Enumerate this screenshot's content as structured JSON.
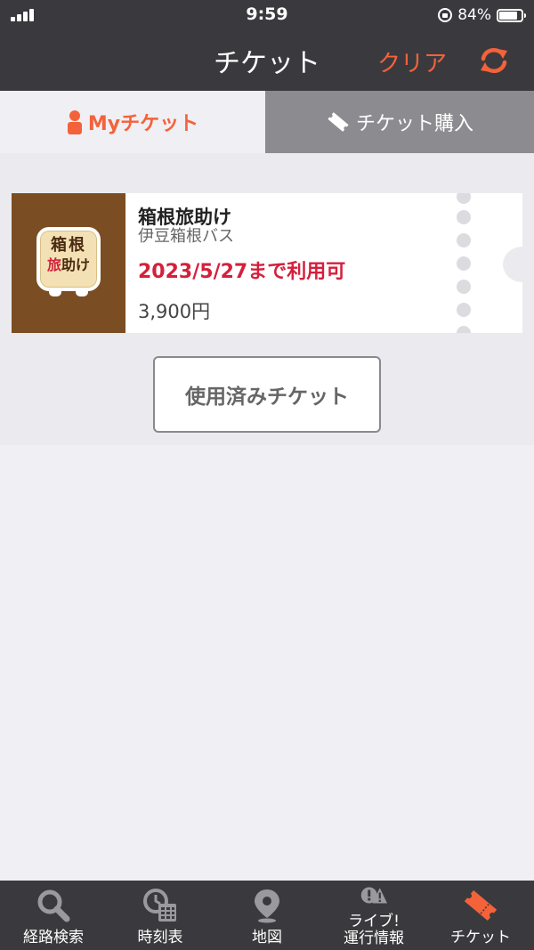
{
  "status_bar": {
    "time": "9:59",
    "battery": "84%",
    "battery_level": 0.84
  },
  "nav": {
    "title": "チケット",
    "clear_label": "クリア",
    "refresh_icon": "refresh-icon"
  },
  "tabs": {
    "my_ticket": {
      "label": "Myチケット",
      "icon": "person-icon"
    },
    "purchase": {
      "label": "チケット購入",
      "icon": "ticket-icon"
    }
  },
  "ticket": {
    "name": "箱根旅助け",
    "company": "伊豆箱根バス",
    "expiry": "2023/5/27まで利用可",
    "price": "3,900円",
    "logo_text": "箱根旅助け"
  },
  "used_tickets_label": "使用済みチケット",
  "tab_bar": {
    "items": [
      {
        "label": "経路検索",
        "icon": "search-icon"
      },
      {
        "label": "時刻表",
        "icon": "timetable-icon"
      },
      {
        "label": "地図",
        "icon": "map-pin-icon"
      },
      {
        "label_line1": "ライブ!",
        "label_line2": "運行情報",
        "icon": "alert-icon"
      },
      {
        "label": "チケット",
        "icon": "ticket-icon",
        "active": true
      }
    ]
  },
  "colors": {
    "accent": "#f4623a",
    "bar": "#3a3a3e",
    "expiry": "#d4203c",
    "thumb_bg": "#7b4d22"
  }
}
